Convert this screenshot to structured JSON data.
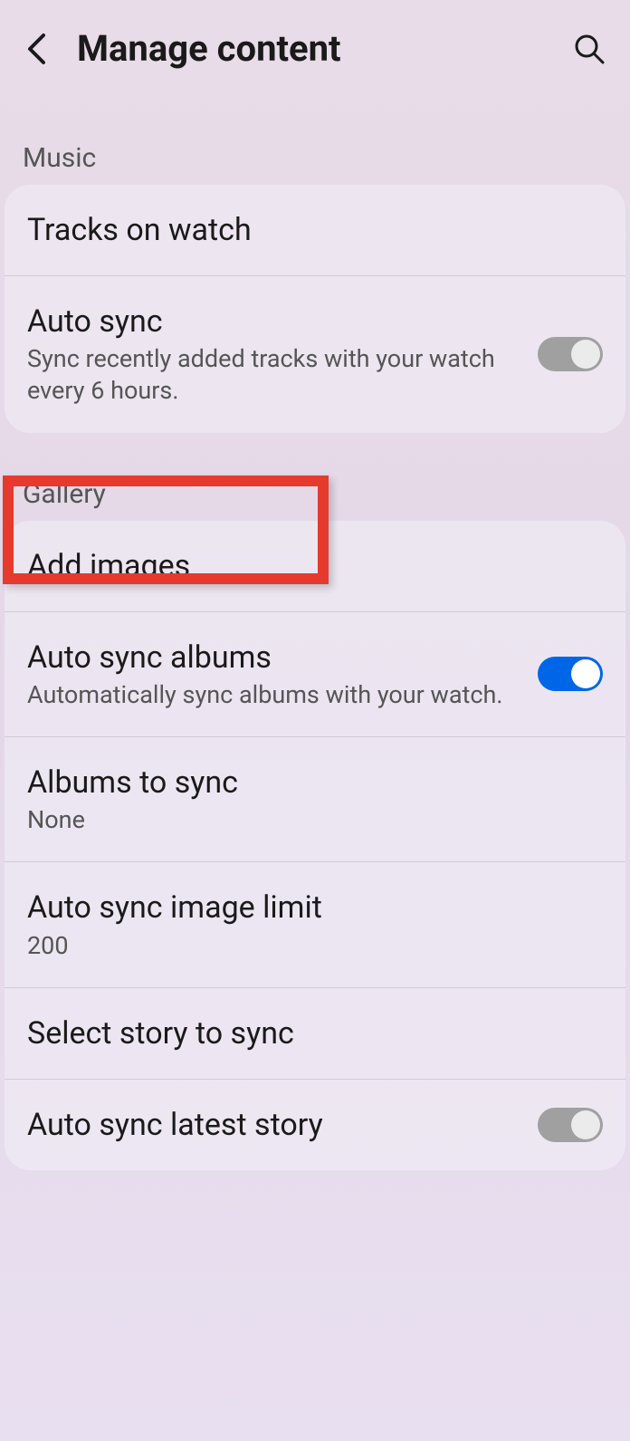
{
  "header": {
    "title": "Manage content"
  },
  "sections": {
    "music": {
      "label": "Music",
      "tracks_on_watch": {
        "title": "Tracks on watch"
      },
      "auto_sync": {
        "title": "Auto sync",
        "subtitle": "Sync recently added tracks with your watch every 6 hours.",
        "enabled": false
      }
    },
    "gallery": {
      "label": "Gallery",
      "add_images": {
        "title": "Add images"
      },
      "auto_sync_albums": {
        "title": "Auto sync albums",
        "subtitle": "Automatically sync albums with your watch.",
        "enabled": true
      },
      "albums_to_sync": {
        "title": "Albums to sync",
        "value": "None"
      },
      "auto_sync_image_limit": {
        "title": "Auto sync image limit",
        "value": "200"
      },
      "select_story": {
        "title": "Select story to sync"
      },
      "auto_sync_latest_story": {
        "title": "Auto sync latest story",
        "enabled": false
      }
    }
  }
}
